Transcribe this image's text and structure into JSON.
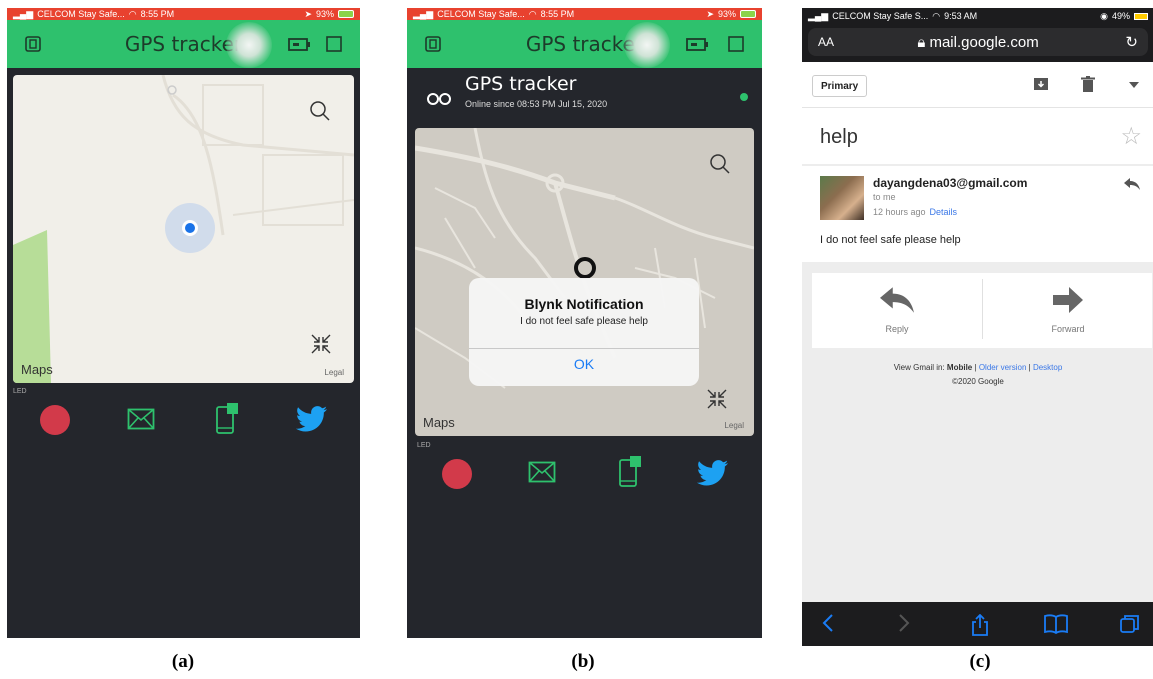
{
  "panel_a": {
    "status": {
      "carrier": "CELCOM Stay Safe...",
      "time": "8:55 PM",
      "battery": "93%"
    },
    "header_title": "GPS tracker",
    "map_label": "Maps",
    "legal": "Legal",
    "led_label": "LED"
  },
  "panel_b": {
    "status": {
      "carrier": "CELCOM Stay Safe...",
      "time": "8:55 PM",
      "battery": "93%"
    },
    "header_title": "GPS tracker",
    "device_name": "GPS tracker",
    "device_status": "Online since 08:53 PM Jul 15, 2020",
    "map_label": "Maps",
    "legal": "Legal",
    "led_label": "LED",
    "notification": {
      "title": "Blynk Notification",
      "body": "I do not feel safe please help",
      "ok": "OK"
    }
  },
  "panel_c": {
    "status": {
      "carrier": "CELCOM Stay Safe S...",
      "time": "9:53 AM",
      "battery": "49%"
    },
    "aa": "AA",
    "url": "mail.google.com",
    "primary_label": "Primary",
    "subject": "help",
    "sender": "dayangdena03@gmail.com",
    "to": "to me",
    "time_ago": "12 hours ago",
    "details": "Details",
    "body": "I do not feel safe please help",
    "reply": "Reply",
    "forward": "Forward",
    "footer_prefix": "View Gmail in:",
    "footer_mobile": "Mobile",
    "footer_sep": "|",
    "footer_older": "Older version",
    "footer_desktop": "Desktop",
    "copyright": "©2020 Google"
  },
  "captions": {
    "a": "(a)",
    "b": "(b)",
    "c": "(c)"
  },
  "colors": {
    "blynk_green": "#2ec16d",
    "dark_bg": "#24262c",
    "led_red": "#d23a4a",
    "twitter_blue": "#1da1f2",
    "status_red": "#e8422f",
    "link_blue": "#3b78e7"
  }
}
